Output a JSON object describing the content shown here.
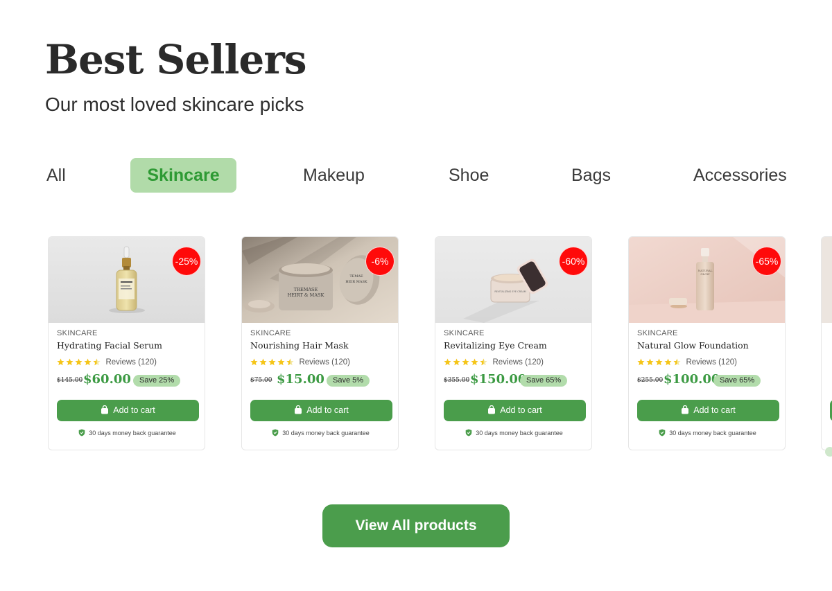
{
  "section": {
    "title": "Best Sellers",
    "subtitle": "Our most loved skincare picks"
  },
  "tabs": [
    {
      "label": "All",
      "active": false
    },
    {
      "label": "Skincare",
      "active": true
    },
    {
      "label": "Makeup",
      "active": false
    },
    {
      "label": "Shoe",
      "active": false
    },
    {
      "label": "Bags",
      "active": false
    },
    {
      "label": "Accessories",
      "active": false
    }
  ],
  "products": [
    {
      "discount": "-25%",
      "category": "SKINCARE",
      "name": "Hydrating Facial Serum",
      "rating": 4.5,
      "reviews": "Reviews (120)",
      "old_price": "$145.00",
      "price": "$60.00",
      "save": "Save 25%",
      "add_to_cart": "Add to cart",
      "guarantee": "30 days money back guarantee",
      "image": "serum-bottle"
    },
    {
      "discount": "-6%",
      "category": "SKINCARE",
      "name": "Nourishing Hair Mask",
      "rating": 4.5,
      "reviews": "Reviews (120)",
      "old_price": "$75.00",
      "price": "$15.00",
      "save": "Save 5%",
      "add_to_cart": "Add to cart",
      "guarantee": "30 days money back guarantee",
      "image": "hair-mask-jar"
    },
    {
      "discount": "-60%",
      "category": "SKINCARE",
      "name": "Revitalizing Eye Cream",
      "rating": 4.5,
      "reviews": "Reviews (120)",
      "old_price": "$355.00",
      "price": "$150.00",
      "save": "Save 65%",
      "add_to_cart": "Add to cart",
      "guarantee": "30 days money back guarantee",
      "image": "eye-cream-jar"
    },
    {
      "discount": "-65%",
      "category": "SKINCARE",
      "name": "Natural Glow Foundation",
      "rating": 4.5,
      "reviews": "Reviews (120)",
      "old_price": "$255.00",
      "price": "$100.00",
      "save": "Save 65%",
      "add_to_cart": "Add to cart",
      "guarantee": "30 days money back guarantee",
      "image": "foundation-bottle"
    }
  ],
  "view_all": "View All products",
  "colors": {
    "accent_green": "#4a9d4b",
    "active_tab_bg": "#b1dba9",
    "active_tab_text": "#2e9a34",
    "price_green": "#3c9a43",
    "badge_red": "#ff0a0a",
    "star_yellow": "#f5c518"
  }
}
